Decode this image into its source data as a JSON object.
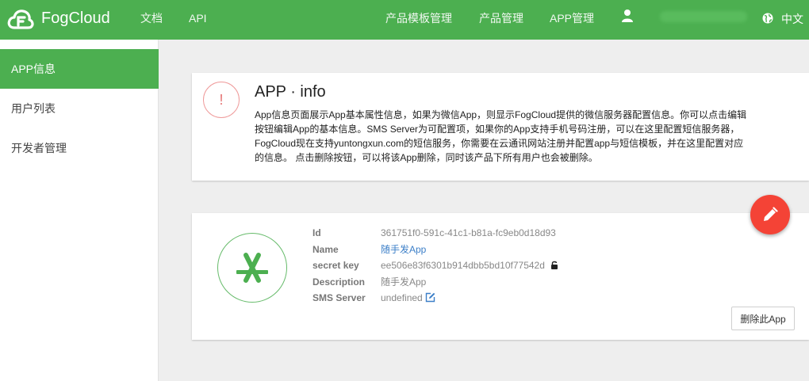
{
  "header": {
    "brand": "FogCloud",
    "nav_left": [
      "文档",
      "API"
    ],
    "nav_right": [
      "产品模板管理",
      "产品管理",
      "APP管理"
    ],
    "language": "中文",
    "icons": {
      "logo": "cloud-f-logo",
      "user": "user-icon",
      "language": "globe-icon"
    }
  },
  "sidebar": {
    "items": [
      {
        "label": "APP信息",
        "active": true
      },
      {
        "label": "用户列表",
        "active": false
      },
      {
        "label": "开发者管理",
        "active": false
      }
    ]
  },
  "info": {
    "title": "APP · info",
    "icon": "!",
    "description": "App信息页面展示App基本属性信息，如果为微信App，则显示FogCloud提供的微信服务器配置信息。你可以点击编辑按钮编辑App的基本信息。SMS Server为可配置项，如果你的App支持手机号码注册，可以在这里配置短信服务器，FogCloud现在支持yuntongxun.com的短信服务，你需要在云通讯网站注册并配置app与短信模板，并在这里配置对应的信息。 点击删除按钮，可以将该App删除，同时该产品下所有用户也会被删除。"
  },
  "app": {
    "fields": {
      "id": {
        "label": "Id",
        "value": "361751f0-591c-41c1-b81a-fc9eb0d18d93"
      },
      "name": {
        "label": "Name",
        "value": "随手发App"
      },
      "secret": {
        "label": "secret key",
        "value": "ee506e83f6301b914dbb5bd10f77542d"
      },
      "desc": {
        "label": "Description",
        "value": "随手发App"
      },
      "sms": {
        "label": "SMS Server",
        "value": "undefined"
      }
    },
    "delete_label": "删除此App"
  },
  "colors": {
    "primary": "#4caf50",
    "danger": "#f44336",
    "link": "#3c7fc8"
  }
}
